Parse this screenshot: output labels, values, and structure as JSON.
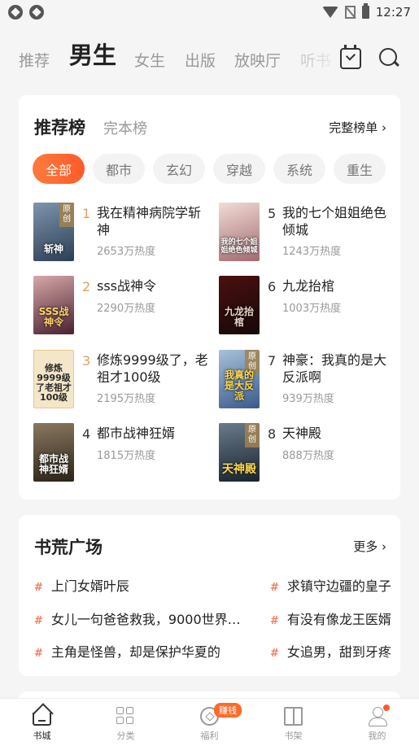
{
  "status_bar": {
    "time": "12:27"
  },
  "top_tabs": {
    "tabs": [
      {
        "label": "推荐"
      },
      {
        "label": "男生"
      },
      {
        "label": "女生"
      },
      {
        "label": "出版"
      },
      {
        "label": "放映厅"
      },
      {
        "label": "听书"
      }
    ],
    "active_index": 1
  },
  "ranking": {
    "title": "推荐榜",
    "subtitle": "完本榜",
    "more_label": "完整榜单 ›",
    "chips": [
      "全部",
      "都市",
      "玄幻",
      "穿越",
      "系统",
      "重生"
    ],
    "books": [
      {
        "rank": "1",
        "title": "我在精神病院学斩神",
        "heat": "2653万热度",
        "cover_text": "斩神",
        "cover_color": "#3a4f6a",
        "tag": "原创"
      },
      {
        "rank": "2",
        "title": "sss战神令",
        "heat": "2290万热度",
        "cover_text": "SSS战神令",
        "cover_color": "#6b3a4a",
        "tag": ""
      },
      {
        "rank": "3",
        "title": "修炼9999级了，老祖才100级",
        "heat": "2195万热度",
        "cover_text": "修炼9999级了老祖才100级",
        "cover_color": "#f2e3c4",
        "tag": ""
      },
      {
        "rank": "4",
        "title": "都市战神狂婿",
        "heat": "1815万热度",
        "cover_text": "都市战神狂婿",
        "cover_color": "#4a3e30",
        "tag": ""
      },
      {
        "rank": "5",
        "title": "我的七个姐姐绝色倾城",
        "heat": "1243万热度",
        "cover_text": "我的七个姐姐绝色倾城",
        "cover_color": "#c9a3a0",
        "tag": ""
      },
      {
        "rank": "6",
        "title": "九龙抬棺",
        "heat": "1003万热度",
        "cover_text": "九龙抬棺",
        "cover_color": "#3a1a1a",
        "tag": ""
      },
      {
        "rank": "7",
        "title": "神豪：我真的是大反派啊",
        "heat": "939万热度",
        "cover_text": "我真的是大反派",
        "cover_color": "#5a7a9a",
        "tag": "原创"
      },
      {
        "rank": "8",
        "title": "天神殿",
        "heat": "888万热度",
        "cover_text": "天神殿",
        "cover_color": "#2a3a4a",
        "tag": "原创"
      }
    ]
  },
  "book_hall": {
    "title": "书荒广场",
    "more_label": "更多 ›",
    "items": [
      "上门女婿叶辰",
      "求镇守边疆的皇子",
      "女儿一句爸爸救我，9000世界…",
      "有没有像龙王医婿",
      "主角是怪兽，却是保护华夏的",
      "女追男，甜到牙疼"
    ]
  },
  "bottom_nav": {
    "items": [
      {
        "label": "书城",
        "icon": "home-icon"
      },
      {
        "label": "分类",
        "icon": "grid-icon"
      },
      {
        "label": "福利",
        "icon": "gift-icon"
      },
      {
        "label": "书架",
        "icon": "bookshelf-icon"
      },
      {
        "label": "我的",
        "icon": "profile-icon"
      }
    ],
    "badge": "赚钱",
    "active_index": 0
  },
  "colors": {
    "accent": "#ff6a2a",
    "rank_top": "#e0a060"
  }
}
